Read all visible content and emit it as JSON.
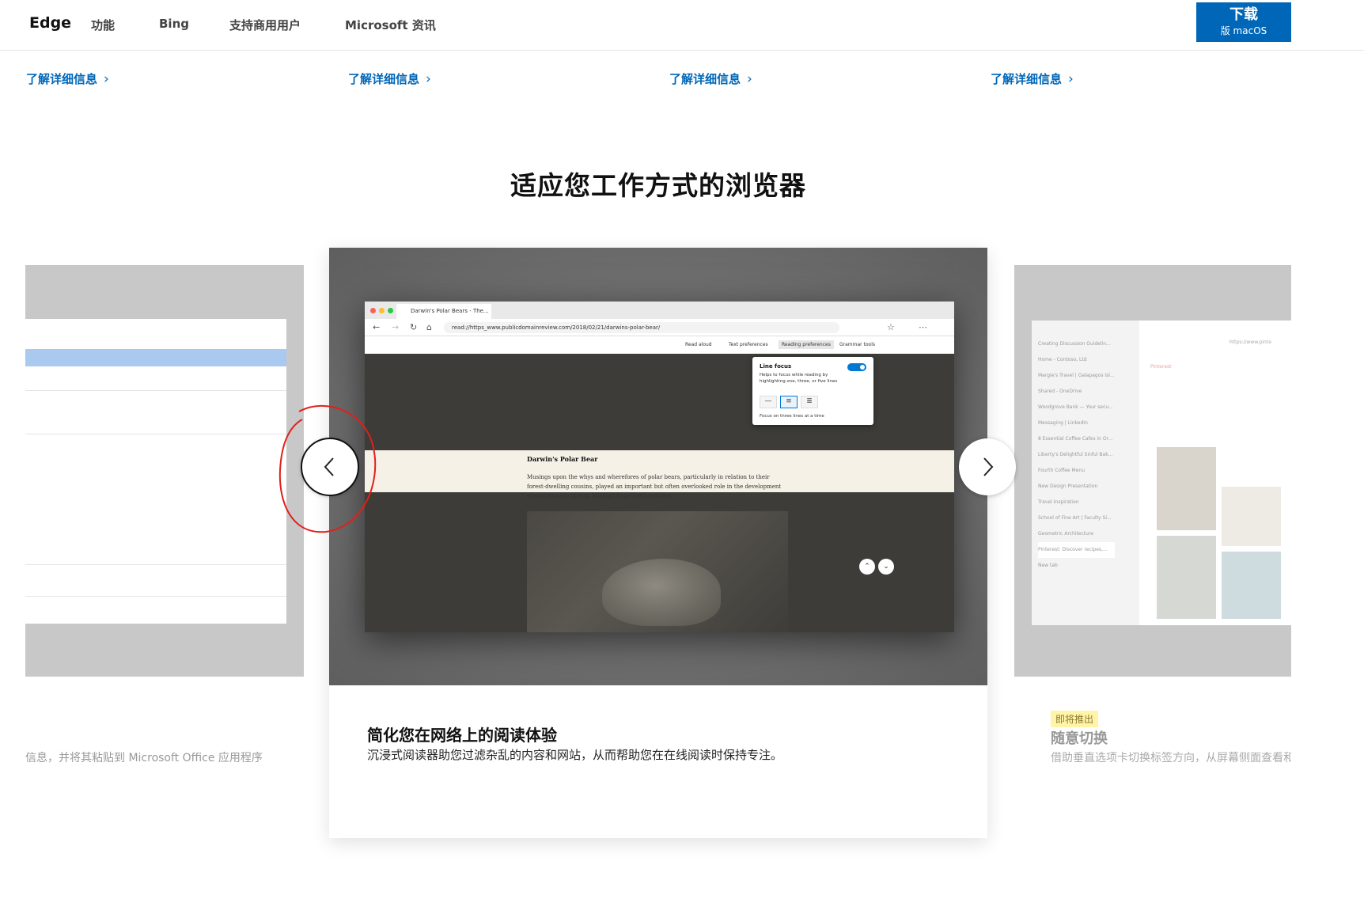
{
  "nav": {
    "brand": "Edge",
    "links": [
      "功能",
      "Bing",
      "支持商用用户",
      "Microsoft 资讯"
    ],
    "download": {
      "line1": "下载",
      "line2": "版 macOS"
    }
  },
  "learn_more": [
    "了解详细信息",
    "了解详细信息",
    "了解详细信息",
    "了解详细信息"
  ],
  "learn_more_chevron": "›",
  "section_title": "适应您工作方式的浏览器",
  "carousel": {
    "left_card": {
      "desc": "信息，并将其粘贴到 Microsoft Office 应用程序"
    },
    "main_card": {
      "title": "简化您在网络上的阅读体验",
      "desc": "沉浸式阅读器助您过滤杂乱的内容和网站，从而帮助您在在线阅读时保持专注。",
      "browser": {
        "tab": "Darwin's Polar Bears - The...",
        "url": "read://https_www.publicdomainreview.com/2018/02/21/darwins-polar-bear/",
        "toolbar": [
          "Read aloud",
          "Text preferences",
          "Reading preferences",
          "Grammar tools"
        ],
        "popover": {
          "title": "Line focus",
          "desc": "Helps to focus while reading by highlighting one, three, or five lines",
          "footer": "Focus on three lines at a time"
        },
        "article_title": "Darwin's Polar Bear",
        "article_text": "Musings upon the whys and wherefores of polar bears, particularly in relation to their forest-dwelling cousins, played an important but often overlooked role in the development of evolutionary theory. Michael Engelhard explores."
      }
    },
    "right_card": {
      "badge": "即将推出",
      "title": "随意切换",
      "desc": "借助垂直选项卡切换标签方向，从屏幕侧面查看和",
      "tabs": [
        "Creating Discussion Guidelin...",
        "Home - Contoso, Ltd",
        "Margie's Travel | Galapagos Isl...",
        "Shared - OneDrive",
        "Woodgrove Bank — Your secu...",
        "Messaging | LinkedIn",
        "8 Essential Coffee Cafes in Or...",
        "Liberty's Delightful Sinful Bak...",
        "Fourth Coffee Menu",
        "New Design Presentation",
        "Travel Inspiration",
        "School of Fine Art | Faculty Si...",
        "Geometric Architecture",
        "Pinterest: Discover recipes,...",
        "New tab"
      ],
      "url": "https://www.pinte",
      "site_name": "Pinterest"
    },
    "prev_label": "‹",
    "next_label": "›"
  }
}
